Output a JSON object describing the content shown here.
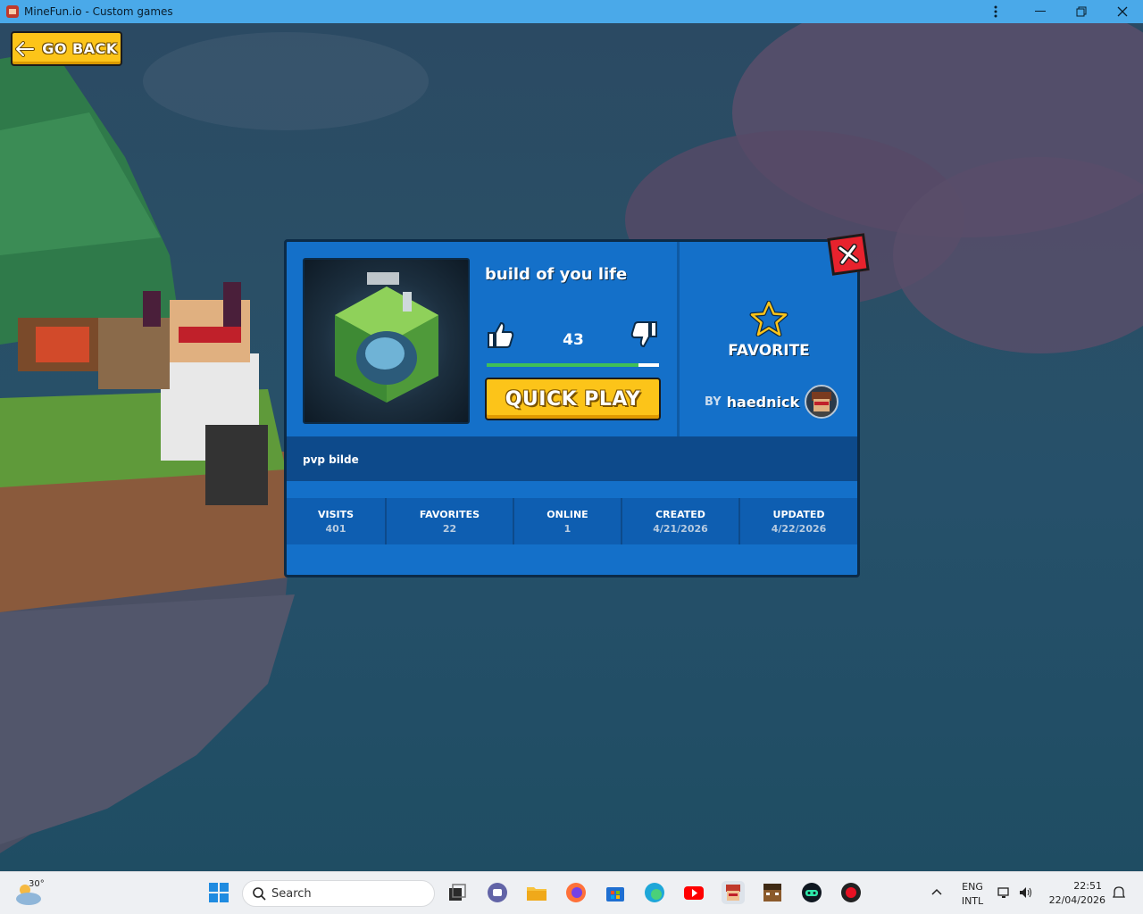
{
  "window": {
    "title": "MineFun.io - Custom games",
    "menu_icon": "kebab-menu-icon",
    "minimize_icon": "minimize-icon",
    "restore_icon": "restore-icon",
    "close_icon": "close-icon"
  },
  "go_back": {
    "label": "GO BACK",
    "icon": "arrow-left-icon"
  },
  "game": {
    "title": "build of you life",
    "likes": "43",
    "like_ratio": 0.88,
    "play_label": "QUICK PLAY",
    "favorite_label": "FAVORITE",
    "by_label": "BY",
    "author": "haednick",
    "description": "pvp bilde",
    "stats": [
      {
        "label": "VISITS",
        "value": "401"
      },
      {
        "label": "FAVORITES",
        "value": "22"
      },
      {
        "label": "ONLINE",
        "value": "1"
      },
      {
        "label": "CREATED",
        "value": "4/21/2026"
      },
      {
        "label": "UPDATED",
        "value": "4/22/2026"
      }
    ]
  },
  "taskbar": {
    "weather_temp": "30°",
    "search_placeholder": "Search",
    "apps": [
      "start-icon",
      "task-view-icon",
      "teams-icon",
      "file-explorer-icon",
      "firefox-icon",
      "store-icon",
      "edge-icon",
      "youtube-icon",
      "minefun-icon",
      "minecraft-icon",
      "copilot-icon",
      "record-icon"
    ],
    "lang_top": "ENG",
    "lang_bottom": "INTL",
    "time": "22:51",
    "date": "22/04/2026"
  },
  "colors": {
    "titlebar": "#4aa9e9",
    "modal_bg": "#1470c9",
    "accent_yellow": "#fcc419",
    "close_red": "#e8222d",
    "like_green": "#40c057"
  }
}
